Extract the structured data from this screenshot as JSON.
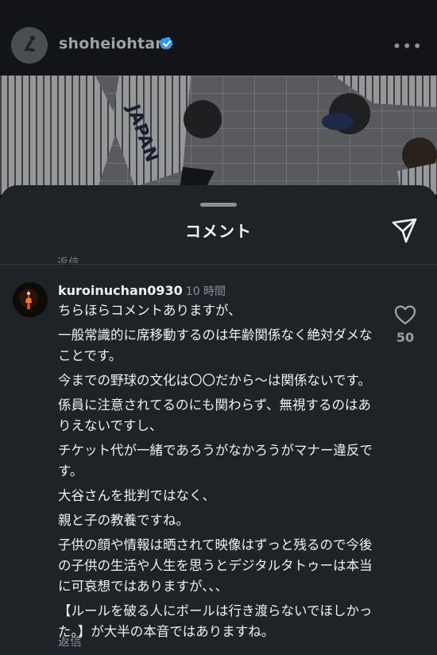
{
  "post": {
    "username": "shoheiohtani",
    "avatar": "avatar",
    "verified_icon": "verified-badge-icon",
    "more_icon": "more-options-icon",
    "photo_text": "JAPAN"
  },
  "sheet": {
    "title": "コメント",
    "share_icon": "send-icon",
    "prev_reply_label": "返信"
  },
  "comment": {
    "username": "kuroinuchan0930",
    "time": "10 時間",
    "lines": [
      "ちらほらコメントありますが、",
      "一般常識的に席移動するのは年齢関係なく絶対ダメなことです。",
      "今までの野球の文化は〇〇だから〜は関係ないです。",
      "係員に注意されてるのにも関わらず、無視するのはありえないですし、",
      "チケット代が一緒であろうがなかろうがマナー違反です。",
      "大谷さんを批判ではなく、",
      "親と子の教養ですね。",
      "子供の顔や情報は晒されて映像はずっと残るので今後の子供の生活や人生を思うとデジタルタトゥーは本当に可哀想ではありますが、、、",
      "【ルールを破る人にボールは行き渡らないでほしかった。】が大半の本音ではありますね。"
    ],
    "like_icon": "heart-icon",
    "like_count": "50",
    "reply_label": "返信"
  },
  "colors": {
    "sheet_bg": "#1f2227",
    "verified": "#3897f0"
  }
}
